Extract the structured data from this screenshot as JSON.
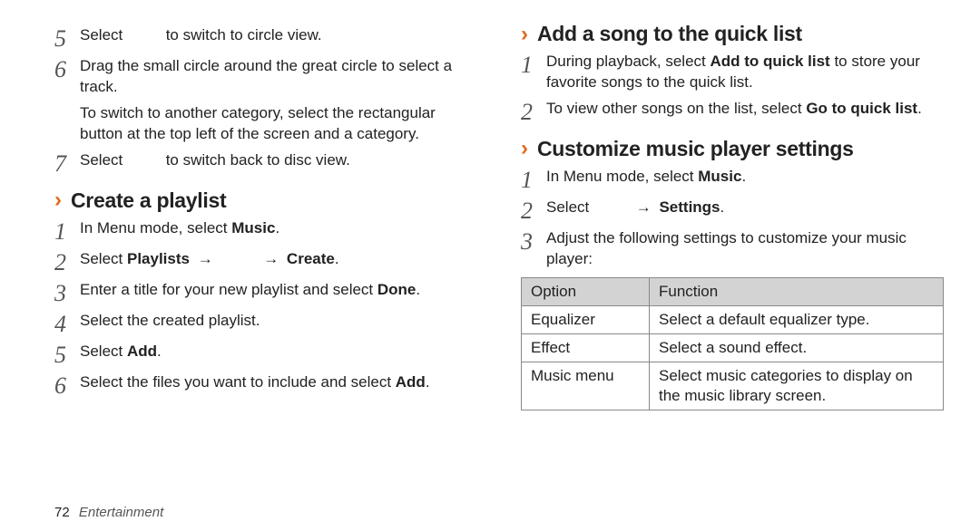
{
  "left": {
    "cont_steps": [
      {
        "n": "5",
        "lines": [
          "Select <span class=\"gap\"></span> to switch to circle view."
        ]
      },
      {
        "n": "6",
        "lines": [
          "Drag the small circle around the great circle to select a track.",
          "To switch to another category, select the rectangular button at the top left of the screen and a category."
        ]
      },
      {
        "n": "7",
        "lines": [
          "Select <span class=\"gap\"></span> to switch back to disc view."
        ]
      }
    ],
    "heading_playlist": "Create a playlist",
    "playlist_steps": [
      {
        "n": "1",
        "lines": [
          "In Menu mode, select <b>Music</b>."
        ]
      },
      {
        "n": "2",
        "lines": [
          "Select <b>Playlists</b> <span class=\"arrow\">→</span> <span class=\"gap\"></span> <span class=\"arrow\">→</span> <b>Create</b>."
        ]
      },
      {
        "n": "3",
        "lines": [
          "Enter a title for your new playlist and select <b>Done</b>."
        ]
      },
      {
        "n": "4",
        "lines": [
          "Select the created playlist."
        ]
      },
      {
        "n": "5",
        "lines": [
          "Select <b>Add</b>."
        ]
      },
      {
        "n": "6",
        "lines": [
          "Select the files you want to include and select <b>Add</b>."
        ]
      }
    ]
  },
  "right": {
    "heading_quicklist": "Add a song to the quick list",
    "quicklist_steps": [
      {
        "n": "1",
        "lines": [
          "During playback, select <b>Add to quick list</b> to store your favorite songs to the quick list."
        ]
      },
      {
        "n": "2",
        "lines": [
          "To view other songs on the list, select <b>Go to quick list</b>."
        ]
      }
    ],
    "heading_settings": "Customize music player settings",
    "settings_steps": [
      {
        "n": "1",
        "lines": [
          "In Menu mode, select <b>Music</b>."
        ]
      },
      {
        "n": "2",
        "lines": [
          "Select <span class=\"gap\"></span> <span class=\"arrow\">→</span> <b>Settings</b>."
        ]
      },
      {
        "n": "3",
        "lines": [
          "Adjust the following settings to customize your music player:"
        ]
      }
    ],
    "table": {
      "head": [
        "Option",
        "Function"
      ],
      "rows": [
        [
          "Equalizer",
          "Select a default equalizer type."
        ],
        [
          "Effect",
          "Select a sound effect."
        ],
        [
          "Music menu",
          "Select music categories to display on the music library screen."
        ]
      ]
    }
  },
  "footer": {
    "page": "72",
    "section": "Entertainment"
  }
}
